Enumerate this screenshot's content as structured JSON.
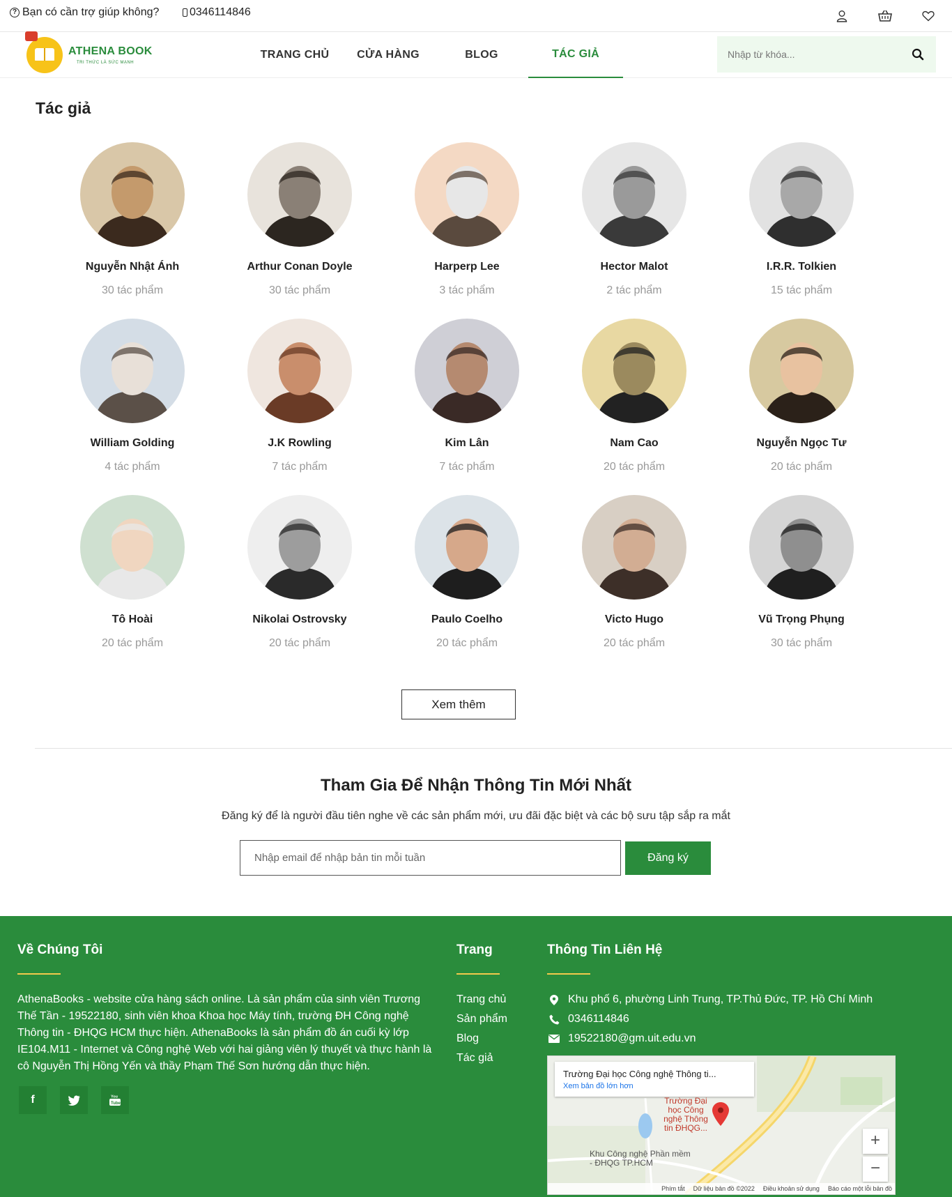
{
  "topbar": {
    "help_text": "Bạn có cần trợ giúp không?",
    "phone": "0346114846",
    "icons": [
      "user-icon",
      "cart-icon",
      "heart-icon"
    ]
  },
  "brand": {
    "name": "ATHENA BOOK",
    "tagline": "TRI THỨC LÀ SỨC MẠNH"
  },
  "nav": {
    "items": [
      {
        "label": "TRANG CHỦ",
        "active": false
      },
      {
        "label": "CỬA HÀNG",
        "active": false
      },
      {
        "label": "BLOG",
        "active": false
      },
      {
        "label": "TÁC GIẢ",
        "active": true
      }
    ],
    "search_placeholder": "Nhập từ khóa..."
  },
  "authors_section": {
    "title": "Tác giả",
    "authors": [
      {
        "name": "Nguyễn Nhật Ánh",
        "count": "30 tác phẩm"
      },
      {
        "name": "Arthur Conan Doyle",
        "count": "30 tác phẩm"
      },
      {
        "name": "Harperp Lee",
        "count": "3 tác phẩm"
      },
      {
        "name": "Hector Malot",
        "count": "2 tác phẩm"
      },
      {
        "name": "I.R.R. Tolkien",
        "count": "15 tác phẩm"
      },
      {
        "name": "William Golding",
        "count": "4 tác phẩm"
      },
      {
        "name": "J.K Rowling",
        "count": "7 tác phẩm"
      },
      {
        "name": "Kim Lân",
        "count": "7 tác phẩm"
      },
      {
        "name": "Nam Cao",
        "count": "20 tác phẩm"
      },
      {
        "name": "Nguyễn Ngọc Tư",
        "count": "20 tác phẩm"
      },
      {
        "name": "Tô Hoài",
        "count": "20 tác phẩm"
      },
      {
        "name": "Nikolai Ostrovsky",
        "count": "20 tác phẩm"
      },
      {
        "name": "Paulo Coelho",
        "count": "20 tác phẩm"
      },
      {
        "name": "Victo Hugo",
        "count": "20 tác phẩm"
      },
      {
        "name": "Vũ Trọng Phụng",
        "count": "30 tác phẩm"
      }
    ],
    "more_button": "Xem thêm"
  },
  "newsletter": {
    "title": "Tham Gia Để Nhận Thông Tin Mới Nhất",
    "description": "Đăng ký để là người đầu tiên nghe về các sản phẩm mới, ưu đãi đặc biệt và các bộ sưu tập sắp ra mắt",
    "email_placeholder": "Nhập email để nhập bản tin mỗi tuần",
    "button": "Đăng ký"
  },
  "footer": {
    "about_title": "Về Chúng Tôi",
    "about_text": "AthenaBooks - website cửa hàng sách online. Là sản phẩm của sinh viên Trương Thế Tần - 19522180, sinh viên khoa Khoa học Máy tính, trường ĐH Công nghệ Thông tin - ĐHQG HCM thực hiện. AthenaBooks là sản phẩm đồ án cuối kỳ lớp IE104.M11 - Internet và Công nghệ Web với hai giảng viên lý thuyết và thực hành là cô Nguyễn Thị Hồng Yến và thầy Phạm Thế Sơn hướng dẫn thực hiện.",
    "social_icons": [
      "facebook-icon",
      "twitter-icon",
      "youtube-icon"
    ],
    "pages_title": "Trang",
    "pages": [
      "Trang chủ",
      "Sản phẩm",
      "Blog",
      "Tác giả"
    ],
    "contact_title": "Thông Tin Liên Hệ",
    "address": "Khu phố 6, phường Linh Trung, TP.Thủ Đức, TP. Hồ Chí Minh",
    "phone": "0346114846",
    "email": "19522180@gm.uit.edu.vn",
    "map": {
      "place_title": "Trường Đại học Công nghệ Thông ti...",
      "view_larger": "Xem bản đồ lớn hơn",
      "pin_label": "Trường Đại học Công nghệ Thông tin ĐHQG...",
      "poi_label": "Khu Công nghệ Phần mềm - ĐHQG TP.HCM",
      "zoom_in": "+",
      "zoom_out": "−",
      "footer_links": [
        "Phím tắt",
        "Dữ liệu bản đồ ©2022",
        "Điều khoản sử dụng",
        "Báo cáo một lỗi bản đồ"
      ]
    }
  }
}
